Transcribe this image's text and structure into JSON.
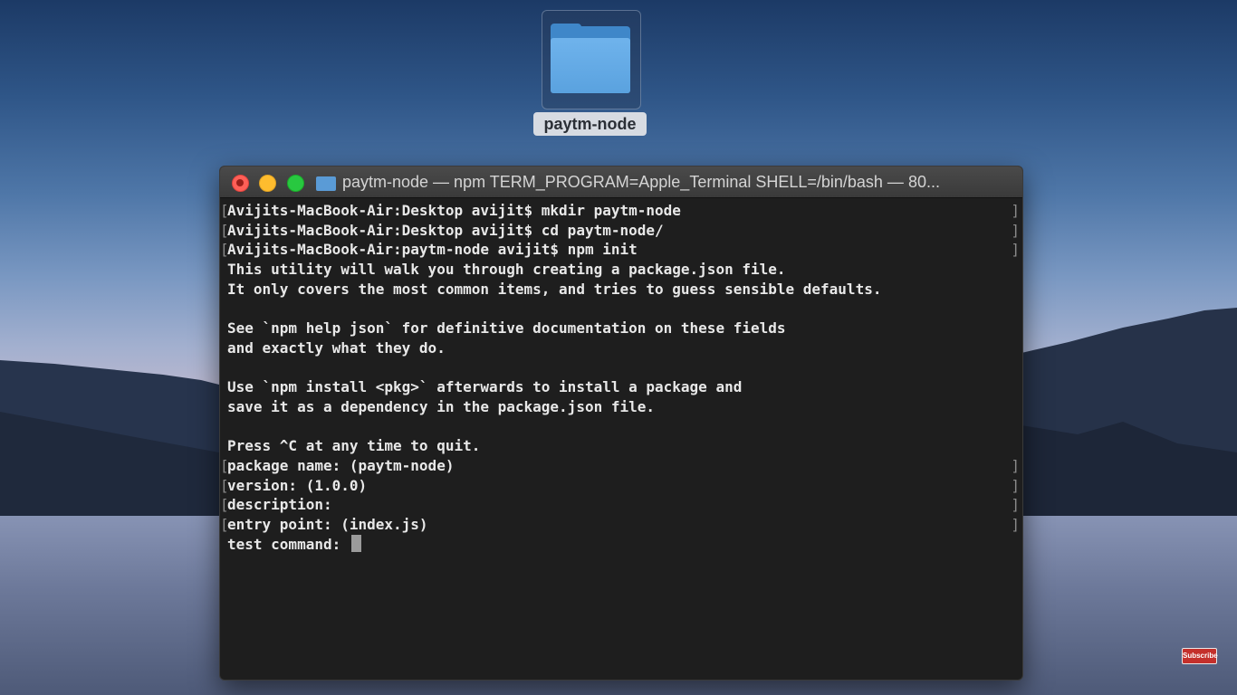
{
  "desktop": {
    "folder": {
      "label": "paytm-node"
    }
  },
  "terminal": {
    "title": "paytm-node — npm TERM_PROGRAM=Apple_Terminal SHELL=/bin/bash — 80...",
    "lines": [
      {
        "text": "Avijits-MacBook-Air:Desktop avijit$ mkdir paytm-node",
        "marked": true
      },
      {
        "text": "Avijits-MacBook-Air:Desktop avijit$ cd paytm-node/",
        "marked": true
      },
      {
        "text": "Avijits-MacBook-Air:paytm-node avijit$ npm init",
        "marked": true
      },
      {
        "text": "This utility will walk you through creating a package.json file.",
        "marked": false
      },
      {
        "text": "It only covers the most common items, and tries to guess sensible defaults.",
        "marked": false
      },
      {
        "text": "",
        "marked": false
      },
      {
        "text": "See `npm help json` for definitive documentation on these fields",
        "marked": false
      },
      {
        "text": "and exactly what they do.",
        "marked": false
      },
      {
        "text": "",
        "marked": false
      },
      {
        "text": "Use `npm install <pkg>` afterwards to install a package and",
        "marked": false
      },
      {
        "text": "save it as a dependency in the package.json file.",
        "marked": false
      },
      {
        "text": "",
        "marked": false
      },
      {
        "text": "Press ^C at any time to quit.",
        "marked": false
      },
      {
        "text": "package name: (paytm-node)",
        "marked": true
      },
      {
        "text": "version: (1.0.0)",
        "marked": true
      },
      {
        "text": "description:",
        "marked": true
      },
      {
        "text": "entry point: (index.js)",
        "marked": true
      }
    ],
    "prompt_line": "test command: "
  },
  "overlay": {
    "subscribe_label": "Subscribe"
  },
  "colors": {
    "terminal_bg": "#1e1e1e",
    "close": "#ff5f57",
    "minimize": "#febc2e",
    "maximize": "#28c840",
    "folder": "#5aa2df",
    "subscribe": "#c4302b"
  }
}
